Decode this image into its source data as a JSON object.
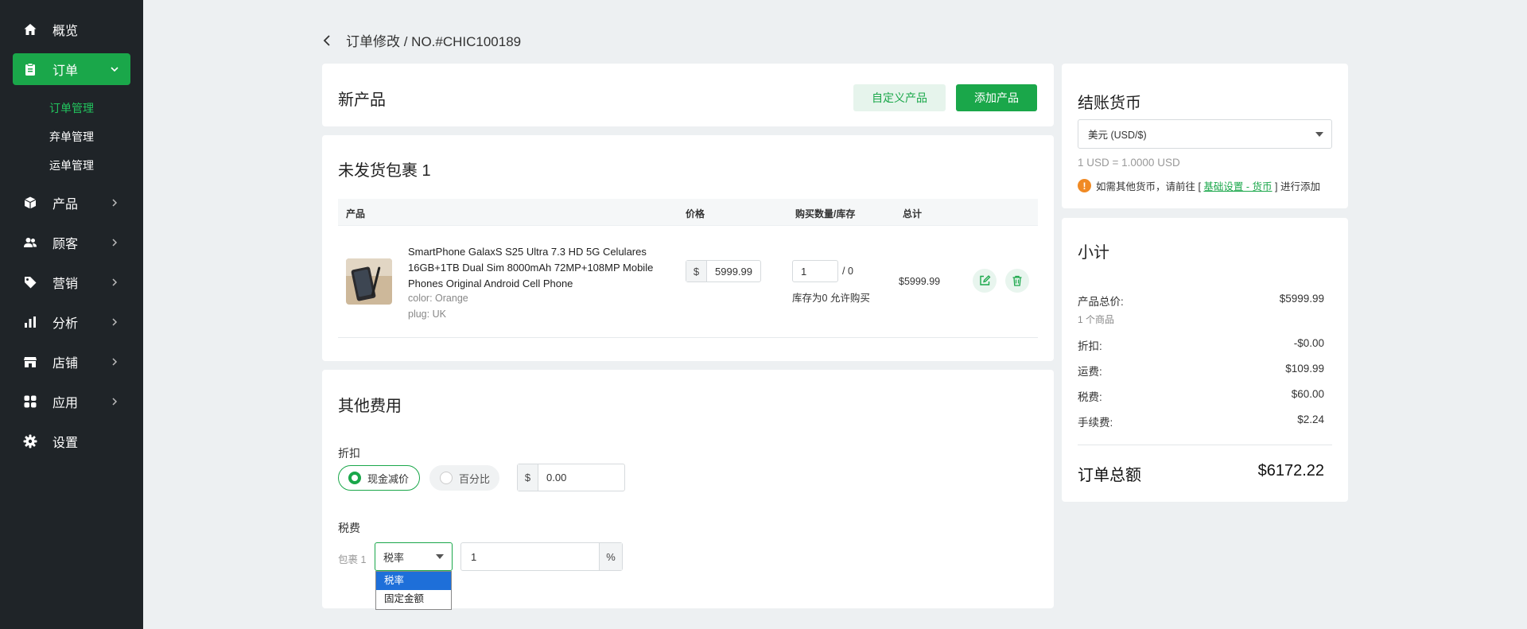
{
  "sidebar": {
    "items": [
      {
        "label": "概览"
      },
      {
        "label": "订单"
      },
      {
        "label": "产品"
      },
      {
        "label": "顾客"
      },
      {
        "label": "营销"
      },
      {
        "label": "分析"
      },
      {
        "label": "店铺"
      },
      {
        "label": "应用"
      },
      {
        "label": "设置"
      }
    ],
    "order_sub": [
      {
        "label": "订单管理"
      },
      {
        "label": "弃单管理"
      },
      {
        "label": "运单管理"
      }
    ]
  },
  "breadcrumb": {
    "text": "订单修改 / NO.#CHIC100189"
  },
  "new_product": {
    "title": "新产品",
    "custom_btn": "自定义产品",
    "add_btn": "添加产品"
  },
  "package": {
    "title": "未发货包裹 1",
    "columns": [
      "产品",
      "价格",
      "购买数量/库存",
      "总计"
    ],
    "item": {
      "name": "SmartPhone GalaxS S25 Ultra 7.3 HD 5G Celulares 16GB+1TB Dual Sim 8000mAh 72MP+108MP Mobile Phones Original Android Cell Phone",
      "color": "color: Orange",
      "plug": "plug: UK",
      "currency_symbol": "$",
      "price": "5999.99",
      "quantity": "1",
      "stock": "/ 0",
      "stock_note": "库存为0 允许购买",
      "total": "$5999.99"
    }
  },
  "other_fees": {
    "title": "其他费用",
    "discount_label": "折扣",
    "discount_options": [
      "现金减价",
      "百分比"
    ],
    "discount_symbol": "$",
    "discount_value": "0.00",
    "tax_label": "税费",
    "package_label": "包裹 1",
    "tax_type": "税率",
    "tax_value": "1",
    "tax_unit": "%",
    "dropdown_options": [
      "税率",
      "固定金额"
    ]
  },
  "checkout_currency": {
    "title": "结账货币",
    "selected": "美元 (USD/$)",
    "rate": "1 USD = 1.0000 USD",
    "note_prefix": "如需其他货币，请前往 [ ",
    "note_link": "基础设置 - 货币",
    "note_suffix": " ] 进行添加"
  },
  "subtotal": {
    "title": "小计",
    "product_total_label": "产品总价:",
    "product_total": "$5999.99",
    "product_count": "1 个商品",
    "discount_label": "折扣:",
    "discount": "-$0.00",
    "shipping_label": "运费:",
    "shipping": "$109.99",
    "tax_label": "税费:",
    "tax": "$60.00",
    "handling_label": "手续费:",
    "handling": "$2.24",
    "order_total_label": "订单总额",
    "order_total": "$6172.22"
  },
  "colors": {
    "accent": "#1aa74a",
    "sidebar_bg": "#1f2428",
    "page_bg": "#edf0f2",
    "warning": "#f08a24",
    "dropdown_highlight": "#1e6fd9"
  }
}
